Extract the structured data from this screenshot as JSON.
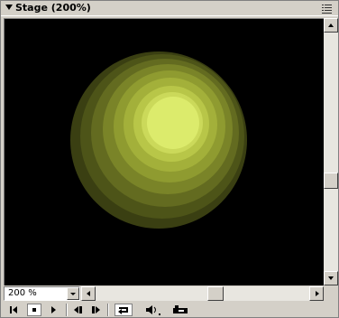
{
  "panel": {
    "title": "Stage (200%)"
  },
  "stage": {
    "background": "#000000",
    "sphere_colors": [
      "#3a3f12",
      "#4d5418",
      "#636b20",
      "#7a8428",
      "#8f9b30",
      "#a3b03a",
      "#b8c648",
      "#cbd95a",
      "#dceb6c"
    ]
  },
  "zoom": {
    "value": "200 %"
  },
  "icons": {
    "title_collapse": "triangle-down-icon",
    "panel_menu": "list-menu-icon",
    "rewind": "rewind-to-start-icon",
    "stop": "stop-icon",
    "play": "play-icon",
    "step_back": "step-backward-icon",
    "step_forward": "step-forward-icon",
    "loop": "loop-icon",
    "volume": "speaker-icon",
    "selection": "selection-only-icon"
  }
}
